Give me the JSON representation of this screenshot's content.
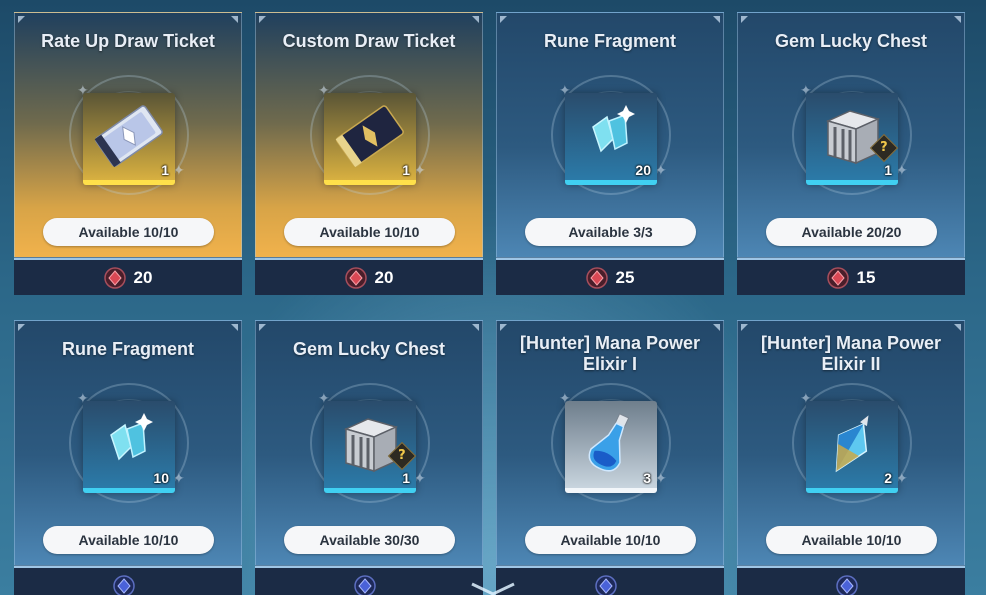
{
  "shop": {
    "items": [
      {
        "name": "Rate Up Draw Ticket",
        "qty": "1",
        "available": "Available 10/10",
        "price": "20",
        "icon": "rate-up-ticket-icon",
        "theme": "gold",
        "slot": "yellow",
        "currency": "red-gem"
      },
      {
        "name": "Custom Draw Ticket",
        "qty": "1",
        "available": "Available 10/10",
        "price": "20",
        "icon": "custom-ticket-icon",
        "theme": "gold",
        "slot": "yellow",
        "currency": "red-gem"
      },
      {
        "name": "Rune Fragment",
        "qty": "20",
        "available": "Available 3/3",
        "price": "25",
        "icon": "rune-fragment-icon",
        "theme": "blue",
        "slot": "blue",
        "currency": "red-gem"
      },
      {
        "name": "Gem Lucky Chest",
        "qty": "1",
        "available": "Available 20/20",
        "price": "15",
        "icon": "lucky-chest-icon",
        "theme": "blue",
        "slot": "blue",
        "currency": "red-gem"
      },
      {
        "name": "Rune Fragment",
        "qty": "10",
        "available": "Available 10/10",
        "price": "",
        "icon": "rune-fragment-icon",
        "theme": "blue",
        "slot": "blue",
        "currency": "blue-gem"
      },
      {
        "name": "Gem Lucky Chest",
        "qty": "1",
        "available": "Available 30/30",
        "price": "",
        "icon": "lucky-chest-icon",
        "theme": "blue",
        "slot": "blue",
        "currency": "blue-gem"
      },
      {
        "name": "[Hunter] Mana Power Elixir I",
        "qty": "3",
        "available": "Available 10/10",
        "price": "",
        "icon": "elixir-icon",
        "theme": "blue",
        "slot": "white",
        "currency": "blue-gem"
      },
      {
        "name": "[Hunter] Mana Power Elixir II",
        "qty": "2",
        "available": "Available 10/10",
        "price": "",
        "icon": "elixir-icon",
        "theme": "blue",
        "slot": "blue",
        "currency": "blue-gem"
      }
    ]
  },
  "colors": {
    "gold_card": "#f1b24c",
    "blue_rarity": "#40d0f2",
    "gold_rarity": "#ffe04a",
    "price_bar": "#1b2b45"
  }
}
